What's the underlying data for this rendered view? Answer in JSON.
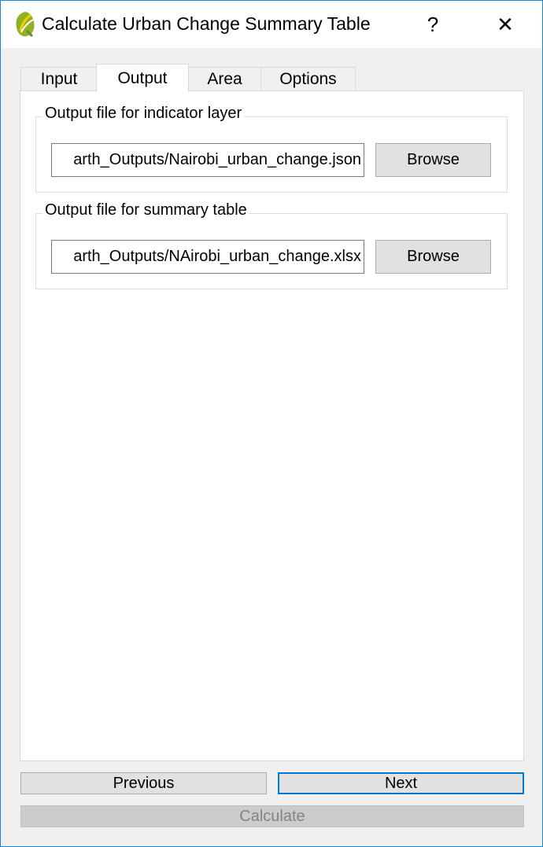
{
  "window": {
    "title": "Calculate Urban Change Summary Table",
    "help_label": "?",
    "close_label": "✕",
    "app_icon": "qgis-logo-icon"
  },
  "tabs": [
    {
      "label": "Input",
      "active": false
    },
    {
      "label": "Output",
      "active": true
    },
    {
      "label": "Area",
      "active": false
    },
    {
      "label": "Options",
      "active": false
    }
  ],
  "output": {
    "indicator_layer": {
      "label": "Output file for indicator layer",
      "value": "arth_Outputs/Nairobi_urban_change.json",
      "browse_label": "Browse"
    },
    "summary_table": {
      "label": "Output file for summary table",
      "value": "arth_Outputs/NAirobi_urban_change.xlsx",
      "browse_label": "Browse"
    }
  },
  "footer": {
    "previous_label": "Previous",
    "next_label": "Next",
    "calculate_label": "Calculate",
    "calculate_enabled": false
  },
  "colors": {
    "accent": "#0078d7",
    "window_border": "#1883d7",
    "disabled_text": "#838383"
  }
}
